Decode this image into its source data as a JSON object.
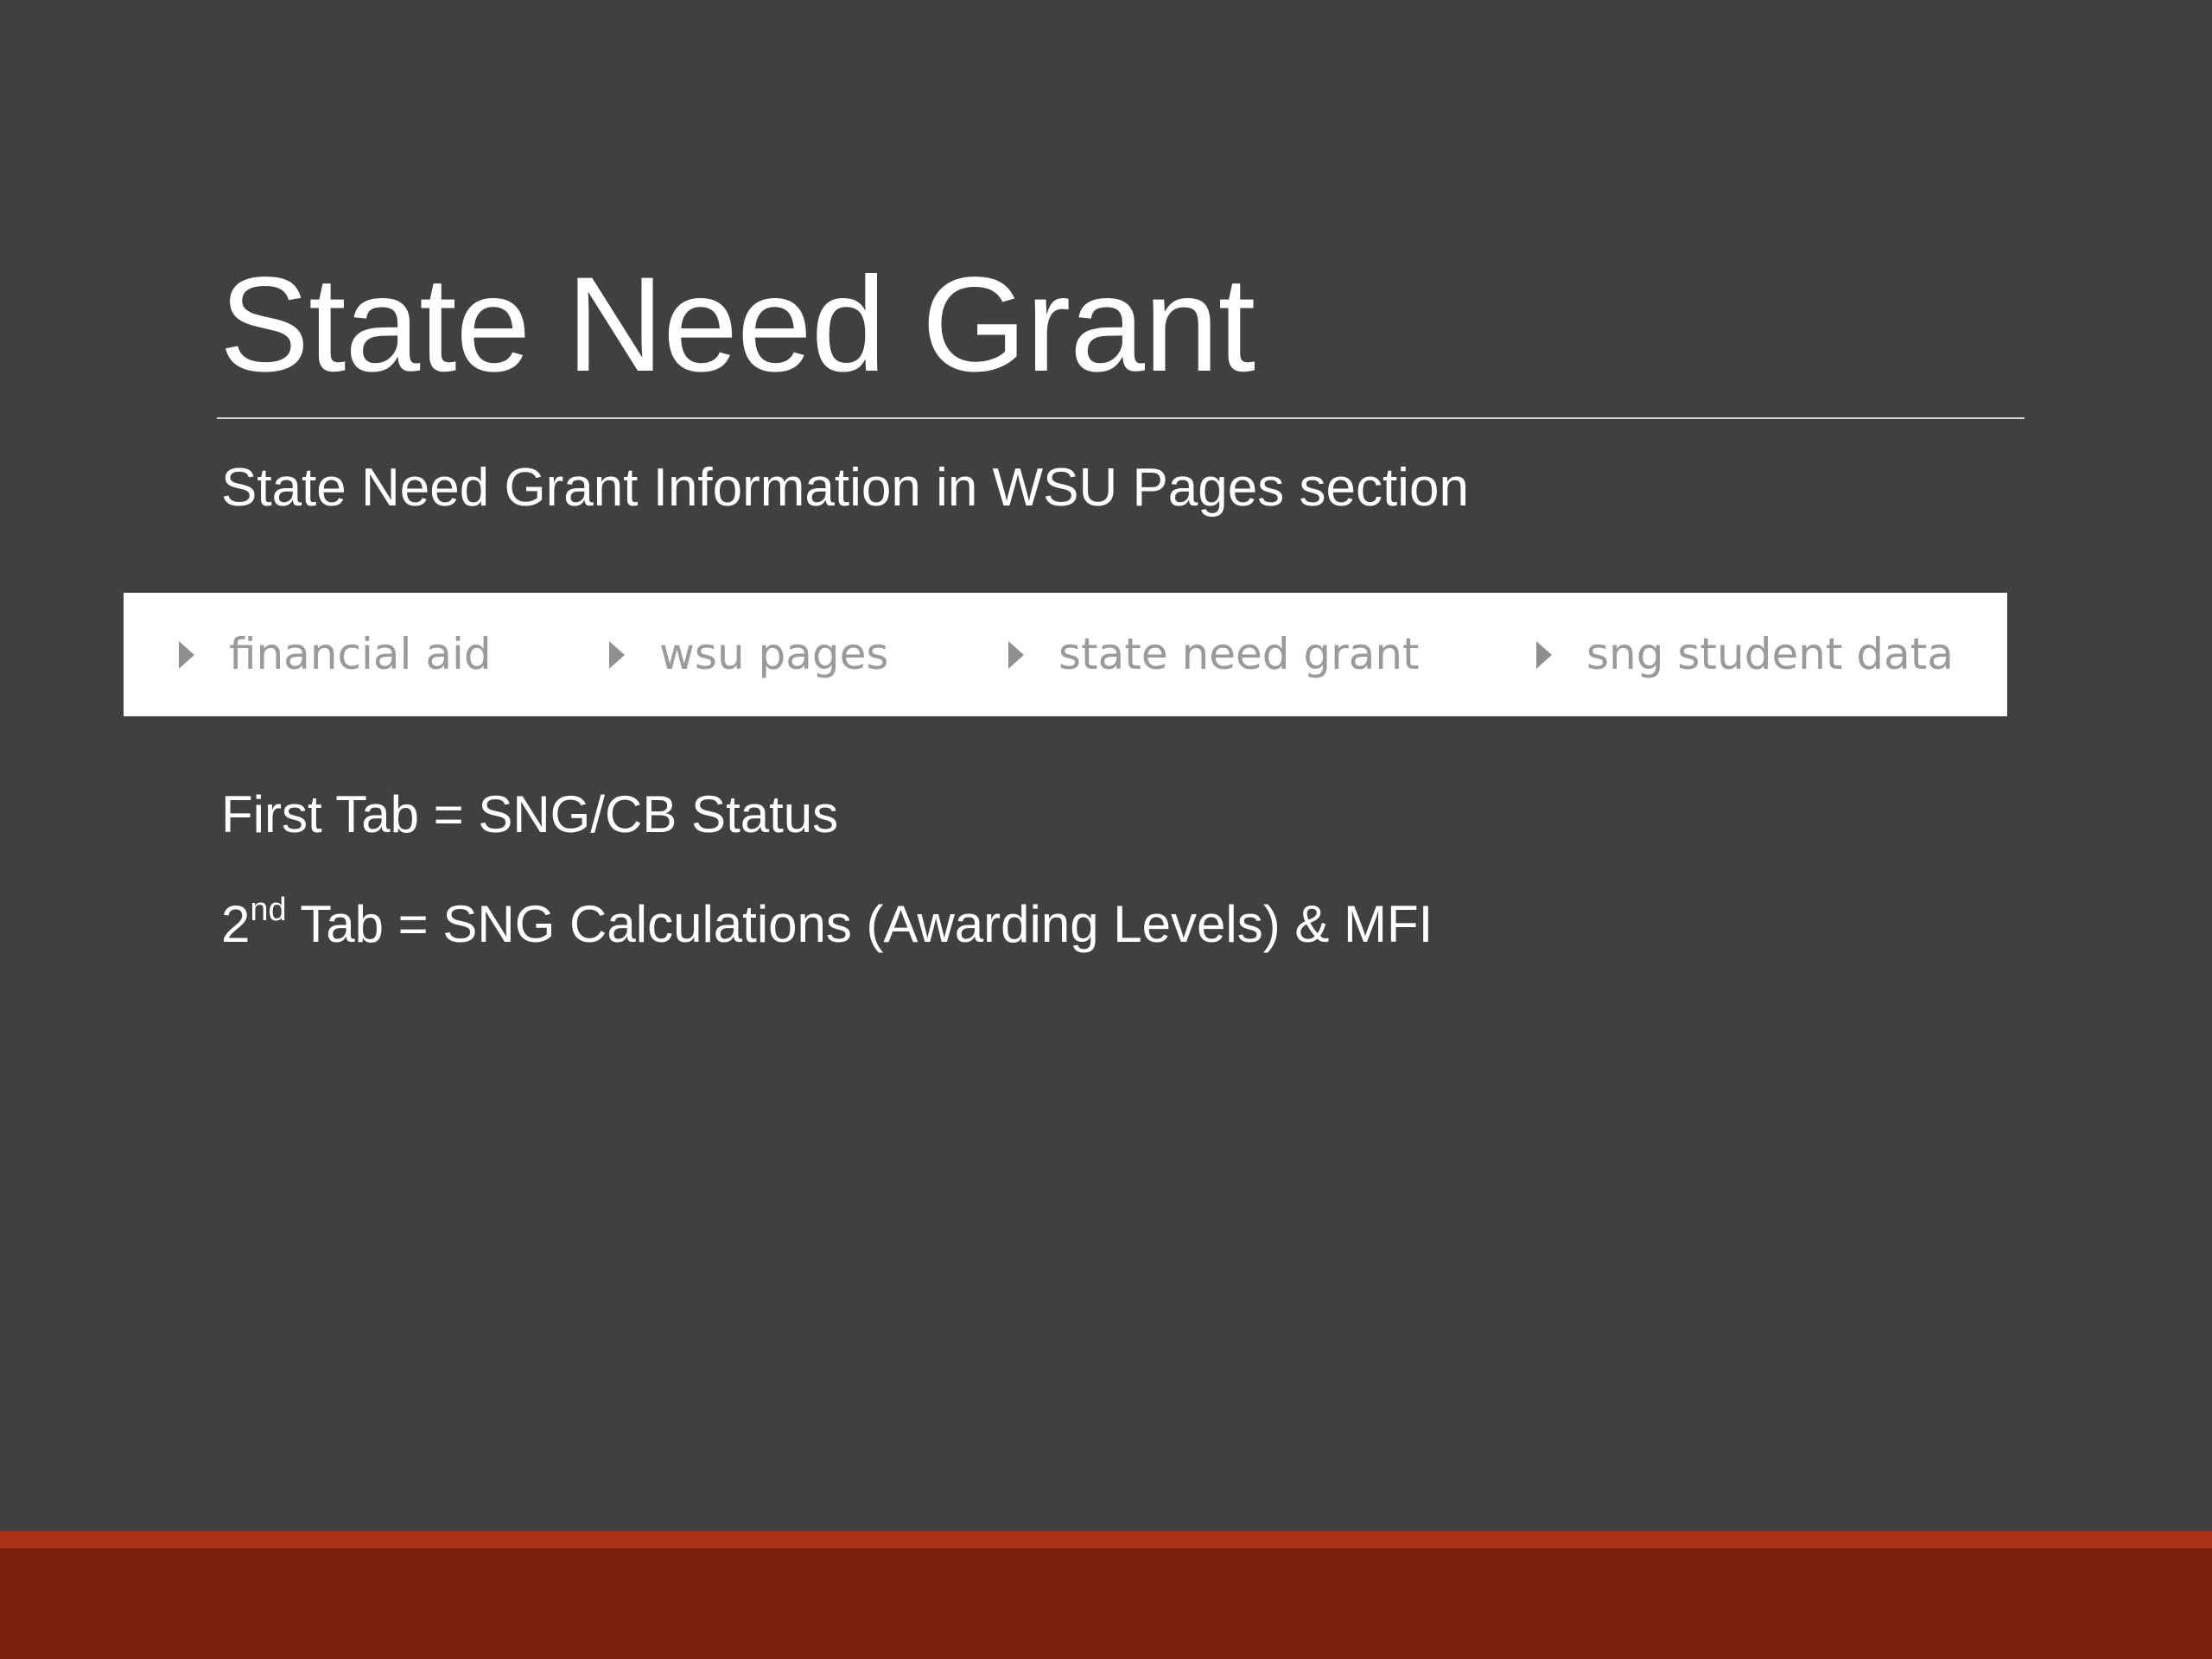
{
  "slide": {
    "title": "State Need Grant",
    "subtitle": "State Need Grant Information in WSU Pages section"
  },
  "breadcrumb": {
    "items": [
      {
        "label": "financial aid",
        "icon": "triangle-right-icon"
      },
      {
        "label": "wsu pages",
        "icon": "triangle-right-icon"
      },
      {
        "label": "state need grant",
        "icon": "triangle-right-icon"
      },
      {
        "label": "sng student data",
        "icon": "triangle-right-icon"
      }
    ]
  },
  "tabs_info": {
    "first": "First Tab = SNG/CB Status",
    "second_number": "2",
    "second_suffix": "nd",
    "second_rest": " Tab = SNG Calculations (Awarding Levels) & MFI"
  },
  "colors": {
    "background": "#404040",
    "accent_stripe": "#a93216",
    "footer_band": "#78200c",
    "breadcrumb_text": "#9a9a9a"
  }
}
